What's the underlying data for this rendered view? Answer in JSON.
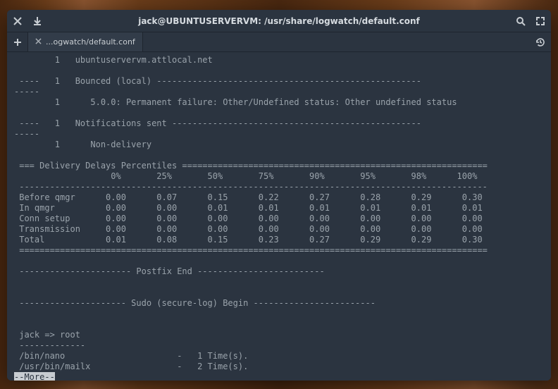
{
  "window": {
    "title": "jack@UBUNTUSERVERVM: /usr/share/logwatch/default.conf",
    "tab_label": "...ogwatch/default.conf"
  },
  "terminal": {
    "lines": [
      "        1   ubuntuservervm.attlocal.net",
      "",
      " ----   1   Bounced (local) ----------------------------------------------------",
      "-----",
      "        1      5.0.0: Permanent failure: Other/Undefined status: Other undefined status",
      "",
      " ----   1   Notifications sent -------------------------------------------------",
      "-----",
      "        1      Non-delivery",
      "",
      " === Delivery Delays Percentiles ============================================================",
      "                   0%       25%       50%       75%       90%       95%       98%      100%",
      " --------------------------------------------------------------------------------------------",
      " Before qmgr      0.00      0.07      0.15      0.22      0.27      0.28      0.29      0.30",
      " In qmgr          0.00      0.00      0.01      0.01      0.01      0.01      0.01      0.01",
      " Conn setup       0.00      0.00      0.00      0.00      0.00      0.00      0.00      0.00",
      " Transmission     0.00      0.00      0.00      0.00      0.00      0.00      0.00      0.00",
      " Total            0.01      0.08      0.15      0.23      0.27      0.29      0.29      0.30",
      " ============================================================================================",
      "",
      " ---------------------- Postfix End -------------------------",
      "",
      "",
      " --------------------- Sudo (secure-log) Begin ------------------------",
      "",
      "",
      " jack => root",
      " -------------",
      " /bin/nano                      -   1 Time(s).",
      " /usr/bin/mailx                 -   2 Time(s)."
    ],
    "more": "--More--"
  }
}
